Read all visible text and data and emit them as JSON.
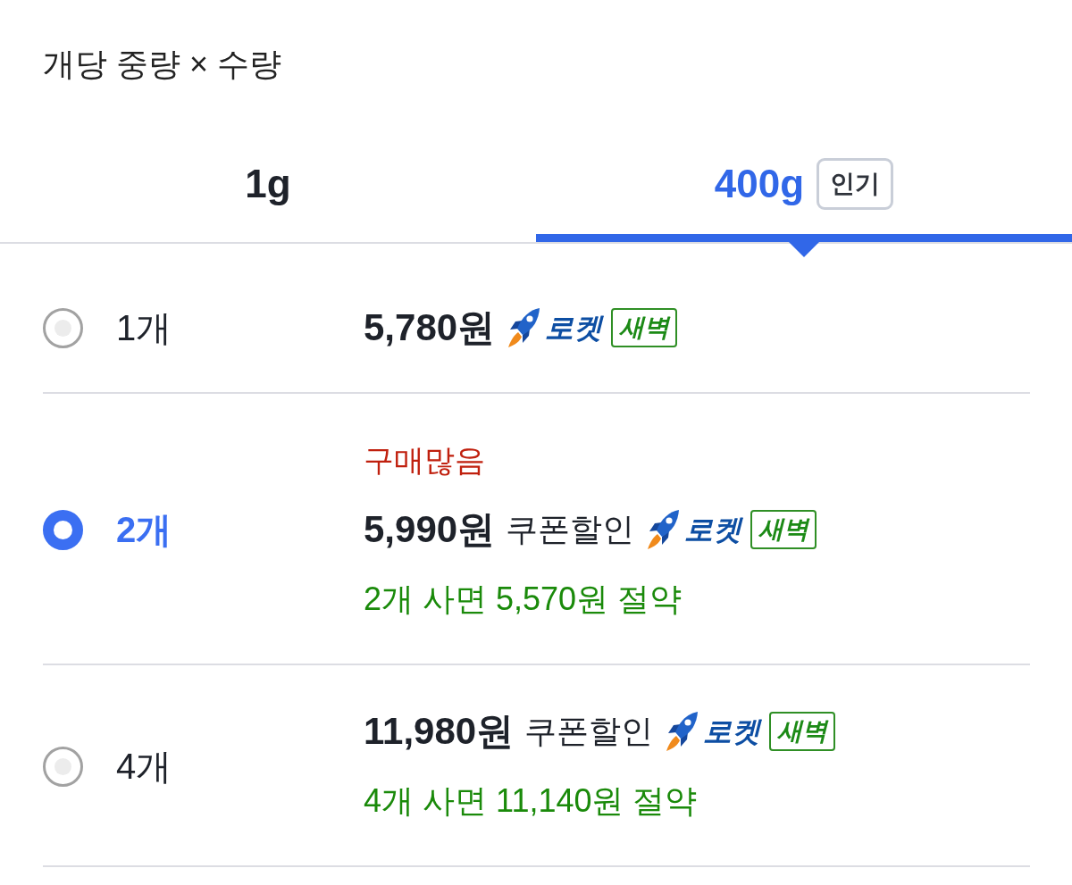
{
  "header": {
    "title": "개당 중량 × 수량"
  },
  "tabs": [
    {
      "label": "1g",
      "selected": false
    },
    {
      "label": "400g",
      "selected": true,
      "badge": "인기"
    }
  ],
  "options": [
    {
      "quantity": "1개",
      "selected": false,
      "price": "5,780원",
      "rocket_label": "로켓",
      "delivery_badge": "새벽"
    },
    {
      "quantity": "2개",
      "selected": true,
      "tag": "구매많음",
      "price": "5,990원",
      "discount_label": "쿠폰할인",
      "rocket_label": "로켓",
      "delivery_badge": "새벽",
      "savings": "2개 사면 5,570원 절약"
    },
    {
      "quantity": "4개",
      "selected": false,
      "price": "11,980원",
      "discount_label": "쿠폰할인",
      "rocket_label": "로켓",
      "delivery_badge": "새벽",
      "savings": "4개 사면 11,140원 절약"
    }
  ]
}
